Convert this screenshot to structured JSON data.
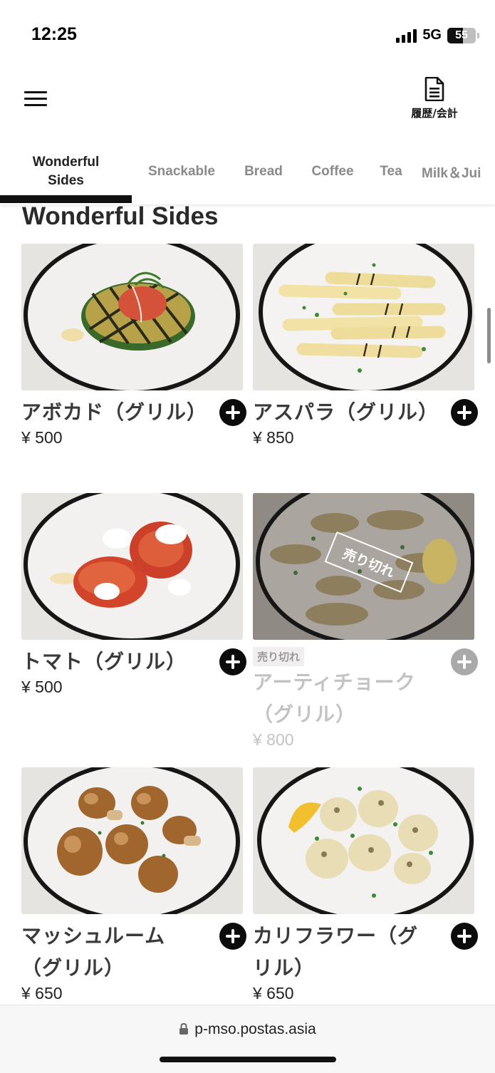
{
  "status_bar": {
    "time": "12:25",
    "network": "5G",
    "battery": "55",
    "battery_level_percent": 55
  },
  "header": {
    "history_label": "履歴/会計",
    "menu_icon": "hamburger-menu-icon",
    "history_icon": "document-icon"
  },
  "tabs": [
    {
      "label": "Wonderful\nSides",
      "active": true
    },
    {
      "label": "Snackable"
    },
    {
      "label": "Bread"
    },
    {
      "label": "Coffee"
    },
    {
      "label": "Tea"
    },
    {
      "label": "Milk＆Jui"
    }
  ],
  "section": {
    "title": "Wonderful Sides"
  },
  "items": [
    {
      "name": "アボカド（グリル）",
      "price": "¥ 500",
      "sold_out": false
    },
    {
      "name": "アスパラ（グリル）",
      "price": "¥ 850",
      "sold_out": false
    },
    {
      "name": "トマト（グリル）",
      "price": "¥ 500",
      "sold_out": false
    },
    {
      "name": "アーティチョーク（グリル）",
      "price": "¥ 800",
      "sold_out": true,
      "badge": "売り切れ",
      "stamp": "売り切れ"
    },
    {
      "name": "マッシュルーム（グリル）",
      "price": "¥ 650",
      "sold_out": false
    },
    {
      "name": "カリフラワー（グリル）",
      "price": "¥ 650",
      "sold_out": false
    }
  ],
  "browser": {
    "url": "p-mso.postas.asia"
  },
  "colors": {
    "accent": "#0c0c0c",
    "disabled": "#a9a9a9",
    "tab_inactive": "#8a8a8a"
  }
}
